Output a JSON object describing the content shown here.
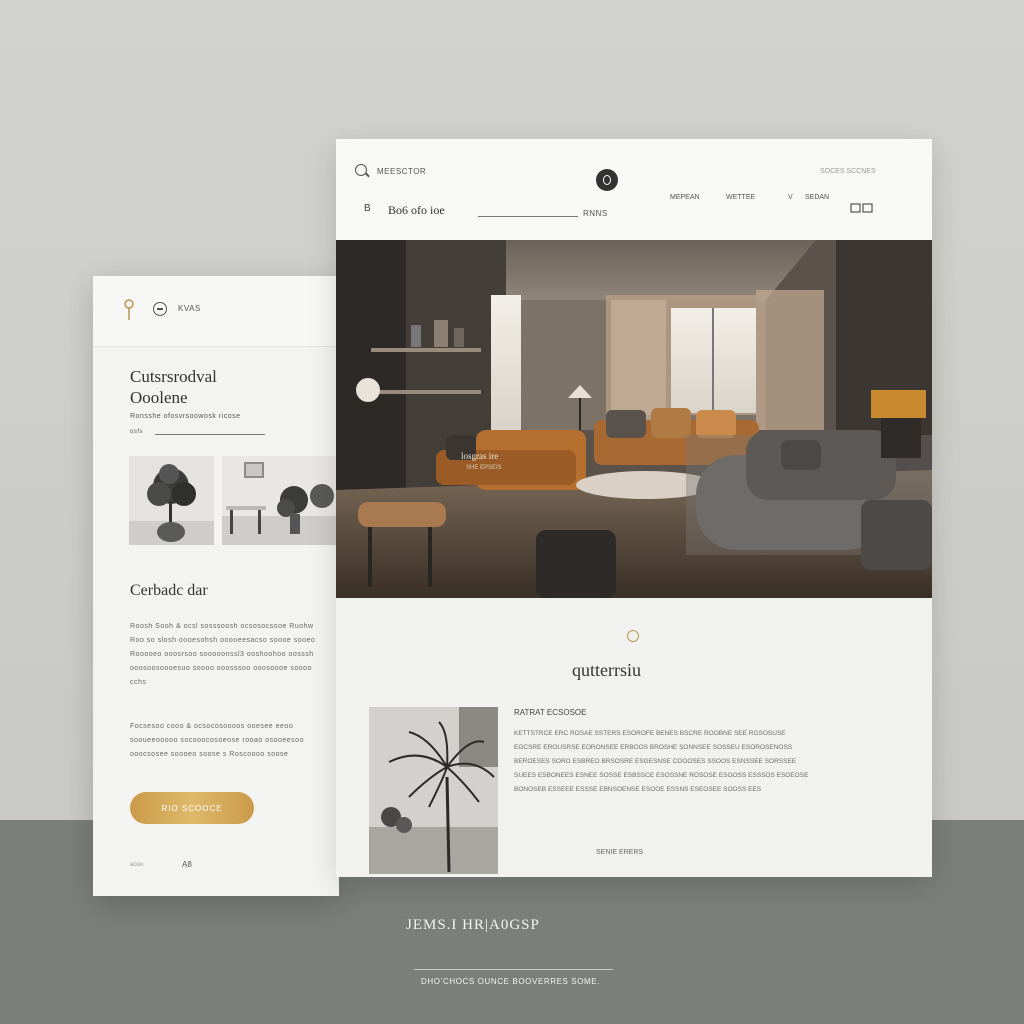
{
  "mobile": {
    "menu_label": "KVAS",
    "title_line1": "Cutsrsrodval",
    "title_line2": "Ooolene",
    "sub": "Ronsshe  ofosvrsoowosk ricose",
    "sub2": "osfs",
    "section_title": "Cerbadc dar",
    "para1": "Roosh Sooh & ocsl sosssoosh ocsosocsooe Ruohw Roo so slosh oooesohsh  ooooeesacso soooe sooeo Rooooeo ooosrsoo sooooonssl3 ooshoohoo oosssh  ooosoosoooesuo soooo ooosssoo ooosoooe soooo cchs",
    "para2": "Focsesoo cooo & ocsocosoooos  ooesee  eeoo sooueeooooo socooocosoeose rooao osooeesoo ooocsosee soooeo soose s Roscoooo soose",
    "button_label": "RIO SCOOCE",
    "foot1": "aooo",
    "foot2": "A8"
  },
  "desktop": {
    "brand_label": "MEESCTOR",
    "top_right_label": "SOCES SCCNES",
    "nav_back": "B",
    "nav_title": "Bo6 ofo ioe",
    "nav_side": "RNNS",
    "nav_items": [
      "MEPEAN",
      "WETTEE",
      "V",
      "SEDAN"
    ],
    "hero_caption": "losgras  ire",
    "hero_caption_sub": "SHE  EPSEIS",
    "section_title": "qutterrsiu",
    "section_heading": "RATRAT ECSOSOE",
    "section_para": "KETTSTRCE ERC ROSAE SSTERS ESOROFE BENES BSCRE ROOBNE SEE RGSOSUSE EGCSRE EROUSRSE EORONSEE ERBOOS BROSHE SONNSEE SOSSEU ESOROSENOSS BEROESES SORO ESBREO BRSOSRE ESGESNSE COOOSES SSOOS ESNSSEE SORSSEE SUEES ESBONEES ESNEE SOSSE ESBSSCE ESOSSNE ROSOSE ESOOSS ESSSOS ESOEOSE BONOSEB ESSEEE ESSSE EBNSOENSE ESOOE ESSNS ESEOSEE SOOSS EES",
    "section_foot": "SENIE  ERERS"
  },
  "footer": {
    "title": "JEMS.I HR|A0GSP",
    "subtitle": "DHO’CHOCS  OUNCE  BOOVERRES  SOME."
  },
  "colors": {
    "accent_gold": "#d4a755",
    "page_top": "#cfcfcb",
    "page_bottom": "#7b7f7b"
  }
}
